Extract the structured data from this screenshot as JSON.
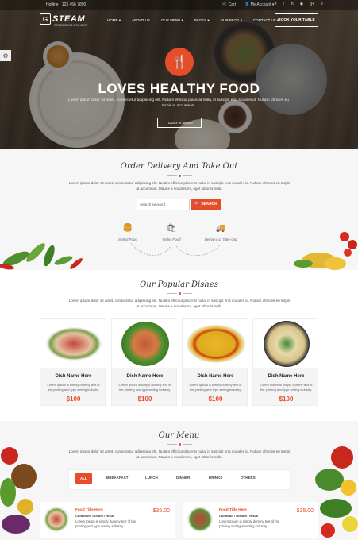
{
  "topbar": {
    "phone": "Hotline : 123 456 7890",
    "cart": "Cart",
    "account": "My Account ▾",
    "socials": [
      "f",
      "t",
      "in",
      "◉",
      "g+",
      "p"
    ]
  },
  "brand": {
    "logo_mark": "G",
    "name": "STEAM",
    "subtitle": "RESTAURANT & DINNER"
  },
  "nav": {
    "items": [
      "HOME ▾",
      "ABOUT US",
      "OUR MENU ▾",
      "PAGES ▾",
      "OUR BLOG ▾",
      "CONTACT US ▾"
    ],
    "book_label": "BOOK YOUR TABLE"
  },
  "hero": {
    "icon": "🍴",
    "title": "LOVES HEALTHY FOOD",
    "text": "Lorem ipsum dolor sit amet, consectetur adipiscing elit. Nullam efficitur placerat nulla, in suscipit erat sodales id. Nullam ultricies eu turpis at accumsan.",
    "button": "TODAY'S MENU"
  },
  "order": {
    "title": "Order Delivery And Take Out",
    "text": "Lorem ipsum dolor sit amet, consectetur adipiscing elit. Nullam efficitur placerat nulla, in suscipit erat sodales id. Nullam ultricies eu turpis at accumsan. Mauris a sodales mi, eget lobortis nulla.",
    "search_placeholder": "Search keyword",
    "search_button": "SEARCH",
    "steps": [
      "Select Food",
      "Order Food",
      "Delivery or Take Out"
    ]
  },
  "dishes": {
    "title": "Our Popular Dishes",
    "text": "Lorem ipsum dolor sit amet, consectetur adipiscing elit. Nullam efficitur placerat nulla, in suscipit erat sodales id. Nullam ultricies eu turpis at accumsan. Mauris a sodales mi, eget lobortis nulla.",
    "items": [
      {
        "name": "Dish Name Here",
        "desc": "Lorem Ipsum is simply dummy text of the printing and type setting industry.",
        "price": "$100"
      },
      {
        "name": "Dish Name Here",
        "desc": "Lorem Ipsum is simply dummy text of the printing and type setting industry.",
        "price": "$100"
      },
      {
        "name": "Dish Name Here",
        "desc": "Lorem Ipsum is simply dummy text of the printing and type setting industry.",
        "price": "$100"
      },
      {
        "name": "Dish Name Here",
        "desc": "Lorem Ipsum is simply dummy text of the printing and type setting industry.",
        "price": "$100"
      }
    ]
  },
  "menu": {
    "title": "Our Menu",
    "text": "Lorem ipsum dolor sit amet, consectetur adipiscing elit. Nullam efficitur placerat nulla, in suscipit erat sodales id. Nullam ultricies eu turpis at accumsan. Mauris a sodales mi, eget lobortis nulla.",
    "tabs": [
      "ALL",
      "BREAKFAST",
      "LUNCH",
      "DINNER",
      "DRINKS",
      "OTHERS"
    ],
    "items": [
      {
        "title": "Food Title Here",
        "category": "Curabitur / Dictum / Risus",
        "desc": "Lorem Ipsum is simply dummy text of the printing and type setting industry.",
        "price": "$35.00"
      },
      {
        "title": "Food Title Here",
        "category": "Curabitur / Dictum / Risus",
        "desc": "Lorem Ipsum is simply dummy text of the printing and type setting industry.",
        "price": "$35.00"
      }
    ]
  },
  "colors": {
    "accent": "#e84d2a",
    "dark_overlay": "#2e2a26",
    "section_bg": "#f6f6f6"
  },
  "icons": {
    "settings": "gear-icon",
    "cart": "cart-icon",
    "account": "user-icon",
    "search": "search-icon"
  }
}
